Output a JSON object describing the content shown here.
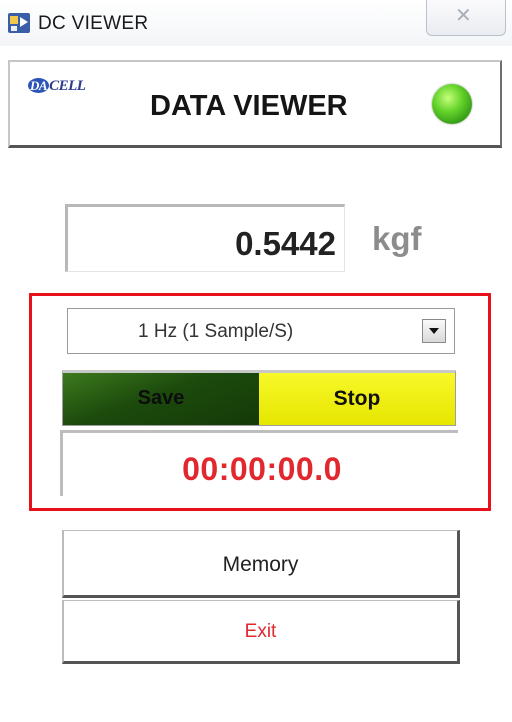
{
  "window": {
    "title": "DC VIEWER",
    "close_glyph": "✕",
    "app_icon": "dc-viewer-app-icon"
  },
  "header": {
    "logo_text": "CELL",
    "logo_mark": "DA",
    "title": "DATA VIEWER",
    "status_led_color": "#4ccf1e"
  },
  "measurement": {
    "value": "0.5442",
    "unit": "kgf"
  },
  "controls": {
    "sample_rate": "1 Hz (1 Sample/S)",
    "save_label": "Save",
    "stop_label": "Stop",
    "timer": "00:00:00.0"
  },
  "actions": {
    "memory_label": "Memory",
    "exit_label": "Exit"
  },
  "colors": {
    "highlight": "#e8101a",
    "timer": "#e0282e",
    "save_button": "#1c4a0c",
    "stop_button": "#f0f014",
    "exit_text": "#e0282e"
  }
}
